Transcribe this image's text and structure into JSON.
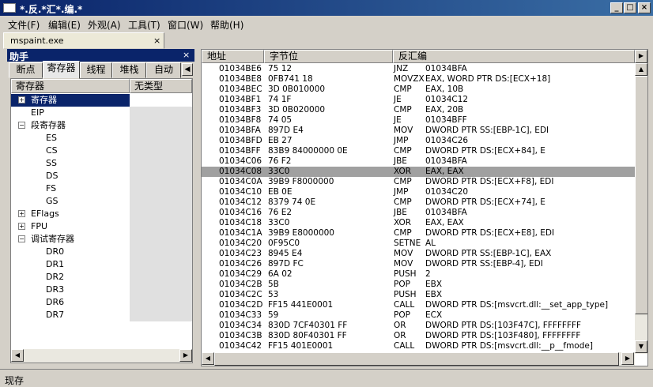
{
  "window": {
    "title": "*.反.*汇*.编.*"
  },
  "menu": [
    "文件(F)",
    "编辑(E)",
    "外观(A)",
    "工具(T)",
    "窗口(W)",
    "帮助(H)"
  ],
  "doc_tab": {
    "label": "mspaint.exe",
    "close": "×"
  },
  "assistant": {
    "title": "助手",
    "close": "×",
    "tabs": [
      "断点",
      "寄存器",
      "线程",
      "堆栈",
      "自动"
    ],
    "columns": [
      "寄存器",
      "无类型"
    ],
    "tree": [
      {
        "label": "寄存器",
        "expander": "+"
      },
      {
        "label": "EIP",
        "expander": ""
      },
      {
        "label": "段寄存器",
        "expander": "−"
      },
      {
        "label": "ES",
        "expander": ""
      },
      {
        "label": "CS",
        "expander": ""
      },
      {
        "label": "SS",
        "expander": ""
      },
      {
        "label": "DS",
        "expander": ""
      },
      {
        "label": "FS",
        "expander": ""
      },
      {
        "label": "GS",
        "expander": ""
      },
      {
        "label": "EFlags",
        "expander": "+"
      },
      {
        "label": "FPU",
        "expander": "+"
      },
      {
        "label": "调试寄存器",
        "expander": "−"
      },
      {
        "label": "DR0",
        "expander": ""
      },
      {
        "label": "DR1",
        "expander": ""
      },
      {
        "label": "DR2",
        "expander": ""
      },
      {
        "label": "DR3",
        "expander": ""
      },
      {
        "label": "DR6",
        "expander": ""
      },
      {
        "label": "DR7",
        "expander": ""
      }
    ]
  },
  "disasm": {
    "columns": [
      "地址",
      "字节位",
      "反汇编"
    ],
    "rows": [
      {
        "addr": "01034BE6",
        "bytes": "75 12",
        "mnem": "JNZ",
        "ops": "01034BFA"
      },
      {
        "addr": "01034BE8",
        "bytes": "0FB741 18",
        "mnem": "MOVZX",
        "ops": "EAX, WORD PTR DS:[ECX+18]"
      },
      {
        "addr": "01034BEC",
        "bytes": "3D 0B010000",
        "mnem": "CMP",
        "ops": "EAX, 10B"
      },
      {
        "addr": "01034BF1",
        "bytes": "74 1F",
        "mnem": "JE",
        "ops": "01034C12"
      },
      {
        "addr": "01034BF3",
        "bytes": "3D 0B020000",
        "mnem": "CMP",
        "ops": "EAX, 20B"
      },
      {
        "addr": "01034BF8",
        "bytes": "74 05",
        "mnem": "JE",
        "ops": "01034BFF"
      },
      {
        "addr": "01034BFA",
        "bytes": "897D E4",
        "mnem": "MOV",
        "ops": "DWORD PTR SS:[EBP-1C], EDI"
      },
      {
        "addr": "01034BFD",
        "bytes": "EB 27",
        "mnem": "JMP",
        "ops": "01034C26"
      },
      {
        "addr": "01034BFF",
        "bytes": "83B9 84000000 0E",
        "mnem": "CMP",
        "ops": "DWORD PTR DS:[ECX+84], E"
      },
      {
        "addr": "01034C06",
        "bytes": "76 F2",
        "mnem": "JBE",
        "ops": "01034BFA"
      },
      {
        "addr": "01034C08",
        "bytes": "33C0",
        "mnem": "XOR",
        "ops": "EAX, EAX"
      },
      {
        "addr": "01034C0A",
        "bytes": "39B9 F8000000",
        "mnem": "CMP",
        "ops": "DWORD PTR DS:[ECX+F8], EDI"
      },
      {
        "addr": "01034C10",
        "bytes": "EB 0E",
        "mnem": "JMP",
        "ops": "01034C20"
      },
      {
        "addr": "01034C12",
        "bytes": "8379 74 0E",
        "mnem": "CMP",
        "ops": "DWORD PTR DS:[ECX+74], E"
      },
      {
        "addr": "01034C16",
        "bytes": "76 E2",
        "mnem": "JBE",
        "ops": "01034BFA"
      },
      {
        "addr": "01034C18",
        "bytes": "33C0",
        "mnem": "XOR",
        "ops": "EAX, EAX"
      },
      {
        "addr": "01034C1A",
        "bytes": "39B9 E8000000",
        "mnem": "CMP",
        "ops": "DWORD PTR DS:[ECX+E8], EDI"
      },
      {
        "addr": "01034C20",
        "bytes": "0F95C0",
        "mnem": "SETNE",
        "ops": "AL"
      },
      {
        "addr": "01034C23",
        "bytes": "8945 E4",
        "mnem": "MOV",
        "ops": "DWORD PTR SS:[EBP-1C], EAX"
      },
      {
        "addr": "01034C26",
        "bytes": "897D FC",
        "mnem": "MOV",
        "ops": "DWORD PTR SS:[EBP-4], EDI"
      },
      {
        "addr": "01034C29",
        "bytes": "6A 02",
        "mnem": "PUSH",
        "ops": "2"
      },
      {
        "addr": "01034C2B",
        "bytes": "5B",
        "mnem": "POP",
        "ops": "EBX"
      },
      {
        "addr": "01034C2C",
        "bytes": "53",
        "mnem": "PUSH",
        "ops": "EBX"
      },
      {
        "addr": "01034C2D",
        "bytes": "FF15 441E0001",
        "mnem": "CALL",
        "ops": "DWORD PTR DS:[msvcrt.dll:__set_app_type]"
      },
      {
        "addr": "01034C33",
        "bytes": "59",
        "mnem": "POP",
        "ops": "ECX"
      },
      {
        "addr": "01034C34",
        "bytes": "830D 7CF40301 FF",
        "mnem": "OR",
        "ops": "DWORD PTR DS:[103F47C], FFFFFFFF"
      },
      {
        "addr": "01034C3B",
        "bytes": "830D 80F40301 FF",
        "mnem": "OR",
        "ops": "DWORD PTR DS:[103F480], FFFFFFFF"
      },
      {
        "addr": "01034C42",
        "bytes": "FF15 401E0001",
        "mnem": "CALL",
        "ops": "DWORD PTR DS:[msvcrt.dll:__p__fmode]"
      }
    ]
  },
  "status": "现存"
}
